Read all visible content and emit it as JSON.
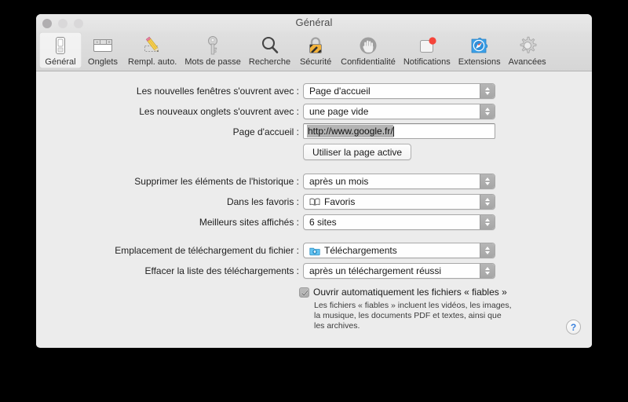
{
  "window": {
    "title": "Général",
    "traffic_lights": [
      "close",
      "minimize",
      "zoom"
    ]
  },
  "toolbar": {
    "items": [
      {
        "label": "Général",
        "icon": "general-icon",
        "selected": true
      },
      {
        "label": "Onglets",
        "icon": "tabs-icon",
        "selected": false
      },
      {
        "label": "Rempl. auto.",
        "icon": "autofill-pencil-icon",
        "selected": false
      },
      {
        "label": "Mots de passe",
        "icon": "key-icon",
        "selected": false
      },
      {
        "label": "Recherche",
        "icon": "search-magnifier-icon",
        "selected": false
      },
      {
        "label": "Sécurité",
        "icon": "padlock-icon",
        "selected": false
      },
      {
        "label": "Confidentialité",
        "icon": "hand-icon",
        "selected": false
      },
      {
        "label": "Notifications",
        "icon": "notification-badge-icon",
        "selected": false
      },
      {
        "label": "Extensions",
        "icon": "puzzle-compass-icon",
        "selected": false
      },
      {
        "label": "Avancées",
        "icon": "gear-icon",
        "selected": false
      }
    ]
  },
  "settings": {
    "new_windows": {
      "label": "Les nouvelles fenêtres s'ouvrent avec :",
      "value": "Page d'accueil"
    },
    "new_tabs": {
      "label": "Les nouveaux onglets s'ouvrent avec :",
      "value": "une page vide"
    },
    "homepage": {
      "label": "Page d'accueil :",
      "value": "http://www.google.fr/",
      "selected": true
    },
    "use_current_page": {
      "label": "Utiliser la page active"
    },
    "remove_history": {
      "label": "Supprimer les éléments de l'historique :",
      "value": "après un mois"
    },
    "favorites": {
      "label": "Dans les favoris :",
      "value": "Favoris",
      "icon": "book-icon"
    },
    "top_sites": {
      "label": "Meilleurs sites affichés :",
      "value": "6 sites"
    },
    "download_location": {
      "label": "Emplacement de téléchargement du fichier :",
      "value": "Téléchargements",
      "icon": "downloads-folder-icon"
    },
    "clear_downloads": {
      "label": "Effacer la liste des téléchargements :",
      "value": "après un téléchargement réussi"
    },
    "open_safe_files": {
      "label": "Ouvrir automatiquement les fichiers « fiables »",
      "checked": true,
      "help": "Les fichiers « fiables » incluent les vidéos, les images, la musique, les documents PDF et textes, ainsi que les archives."
    }
  },
  "help_button": {
    "label": "?"
  },
  "colors": {
    "window_background": "#ececec",
    "toolbar_top": "#e0e0e0",
    "selection_gray": "#b4b4b4",
    "help_blue": "#3b82de",
    "extension_blue": "#3ba0e8",
    "notification_red": "#f5443a",
    "downloads_blue": "#63c4f2"
  }
}
